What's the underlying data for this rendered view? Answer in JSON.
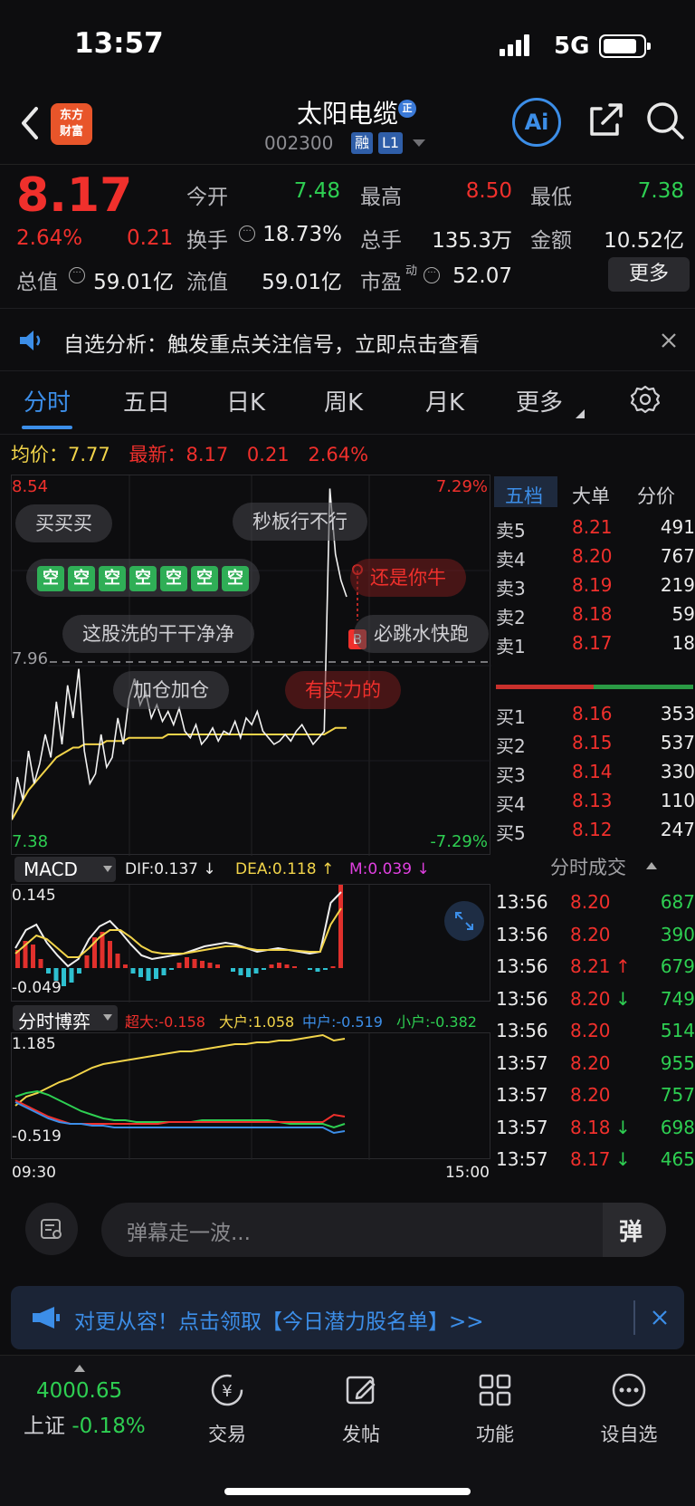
{
  "status": {
    "time": "13:57",
    "network": "5G"
  },
  "header": {
    "logo_line1": "东方",
    "logo_line2": "财富",
    "stock_name": "太阳电缆",
    "badge": "正",
    "code": "002300",
    "tag1": "融",
    "tag2": "L1",
    "ai_label": "Ai"
  },
  "quote": {
    "price": "8.17",
    "change_pct": "2.64%",
    "change": "0.21",
    "open_label": "今开",
    "open": "7.48",
    "high_label": "最高",
    "high": "8.50",
    "low_label": "最低",
    "low": "7.38",
    "turnover_label": "换手",
    "turnover": "18.73%",
    "volume_label": "总手",
    "volume": "135.3万",
    "amount_label": "金额",
    "amount": "10.52亿",
    "mktcap_label": "总值",
    "mktcap": "59.01亿",
    "float_label": "流值",
    "float": "59.01亿",
    "pe_label": "市盈",
    "pe_sup": "动",
    "pe": "52.07",
    "more_label": "更多"
  },
  "notice": {
    "text": "自选分析：触发重点关注信号，立即点击查看"
  },
  "tabs": [
    "分时",
    "五日",
    "日K",
    "周K",
    "月K",
    "更多"
  ],
  "infoline": {
    "avg_label": "均价：",
    "avg": "7.77",
    "latest_label": "最新：",
    "latest": "8.17",
    "chg": "0.21",
    "pct": "2.64%"
  },
  "chart": {
    "ymax": "8.54",
    "ymin": "7.38",
    "pmax": "7.29%",
    "pmin": "-7.29%",
    "ref": "7.96",
    "marker_b": "B",
    "series_price": [
      7.49,
      7.62,
      7.55,
      7.7,
      7.6,
      7.66,
      7.75,
      7.68,
      7.85,
      7.72,
      7.9,
      7.8,
      7.95,
      7.7,
      7.6,
      7.63,
      7.75,
      7.65,
      7.68,
      7.8,
      7.72,
      7.86,
      7.92,
      7.84,
      7.88,
      7.8,
      7.84,
      7.79,
      7.82,
      7.78,
      7.83,
      7.76,
      7.74,
      7.78,
      7.72,
      7.74,
      7.77,
      7.73,
      7.76,
      7.75,
      7.79,
      7.74,
      7.8,
      7.78,
      7.82,
      7.76,
      7.74,
      7.72,
      7.73,
      7.75,
      7.73,
      7.76,
      7.78,
      7.75,
      7.72,
      7.74,
      7.76,
      8.5,
      8.3,
      8.22,
      8.17
    ],
    "series_avg": [
      7.49,
      7.52,
      7.55,
      7.58,
      7.6,
      7.62,
      7.64,
      7.66,
      7.68,
      7.69,
      7.7,
      7.71,
      7.71,
      7.72,
      7.72,
      7.72,
      7.72,
      7.73,
      7.73,
      7.73,
      7.73,
      7.74,
      7.74,
      7.74,
      7.74,
      7.74,
      7.74,
      7.74,
      7.75,
      7.75,
      7.75,
      7.75,
      7.75,
      7.75,
      7.75,
      7.75,
      7.75,
      7.75,
      7.75,
      7.75,
      7.75,
      7.75,
      7.75,
      7.75,
      7.75,
      7.75,
      7.75,
      7.75,
      7.75,
      7.75,
      7.75,
      7.75,
      7.75,
      7.75,
      7.75,
      7.75,
      7.75,
      7.76,
      7.77,
      7.77,
      7.77
    ]
  },
  "danmu": [
    {
      "text": "买买买",
      "style": "gray"
    },
    {
      "text": "秒板行不行",
      "style": "gray"
    },
    {
      "text": "还是你牛",
      "style": "red"
    },
    {
      "text": "这股洗的干干净净",
      "style": "gray"
    },
    {
      "text": "必跳水快跑",
      "style": "gray"
    },
    {
      "text": "加仓加仓",
      "style": "gray"
    },
    {
      "text": "有实力的",
      "style": "red"
    }
  ],
  "danmu_kong": "空",
  "book": {
    "tabs": [
      "五档",
      "大单",
      "分价"
    ],
    "asks": [
      {
        "label": "卖5",
        "price": "8.21",
        "vol": "491"
      },
      {
        "label": "卖4",
        "price": "8.20",
        "vol": "767"
      },
      {
        "label": "卖3",
        "price": "8.19",
        "vol": "219"
      },
      {
        "label": "卖2",
        "price": "8.18",
        "vol": "59"
      },
      {
        "label": "卖1",
        "price": "8.17",
        "vol": "18"
      }
    ],
    "bids": [
      {
        "label": "买1",
        "price": "8.16",
        "vol": "353"
      },
      {
        "label": "买2",
        "price": "8.15",
        "vol": "537"
      },
      {
        "label": "买3",
        "price": "8.14",
        "vol": "330"
      },
      {
        "label": "买4",
        "price": "8.13",
        "vol": "110"
      },
      {
        "label": "买5",
        "price": "8.12",
        "vol": "247"
      }
    ]
  },
  "macd": {
    "title": "MACD",
    "dif": "DIF:0.137 ↓",
    "dea": "DEA:0.118 ↑",
    "m": "M:0.039 ↓",
    "ymax": "0.145",
    "ymin": "-0.049"
  },
  "bo": {
    "title": "分时博弈",
    "chaoda": "超大:-0.158",
    "dahu": "大户:1.058",
    "zhonghu": "中户:-0.519",
    "xiaohu": "小户:-0.382",
    "ymax": "1.185",
    "ymin": "-0.519",
    "t_start": "09:30",
    "t_end": "15:00"
  },
  "trades": {
    "title": "分时成交",
    "rows": [
      {
        "time": "13:56",
        "price": "8.20",
        "vol": "687",
        "arrow": ""
      },
      {
        "time": "13:56",
        "price": "8.20",
        "vol": "390",
        "arrow": ""
      },
      {
        "time": "13:56",
        "price": "8.21",
        "vol": "679",
        "arrow": "↑"
      },
      {
        "time": "13:56",
        "price": "8.20",
        "vol": "749",
        "arrow": "↓"
      },
      {
        "time": "13:56",
        "price": "8.20",
        "vol": "514",
        "arrow": ""
      },
      {
        "time": "13:57",
        "price": "8.20",
        "vol": "955",
        "arrow": ""
      },
      {
        "time": "13:57",
        "price": "8.20",
        "vol": "757",
        "arrow": ""
      },
      {
        "time": "13:57",
        "price": "8.18",
        "vol": "698",
        "arrow": "↓"
      },
      {
        "time": "13:57",
        "price": "8.17",
        "vol": "465",
        "arrow": "↓"
      }
    ]
  },
  "comment": {
    "placeholder": "弹幕走一波...",
    "btn": "弹"
  },
  "ad": {
    "text": "对更从容！点击领取【今日潜力股名单】>>"
  },
  "nav": {
    "index_value": "4000.65",
    "index_name": "上证",
    "index_pct": "-0.18%",
    "items": [
      "交易",
      "发帖",
      "功能",
      "设自选"
    ]
  }
}
